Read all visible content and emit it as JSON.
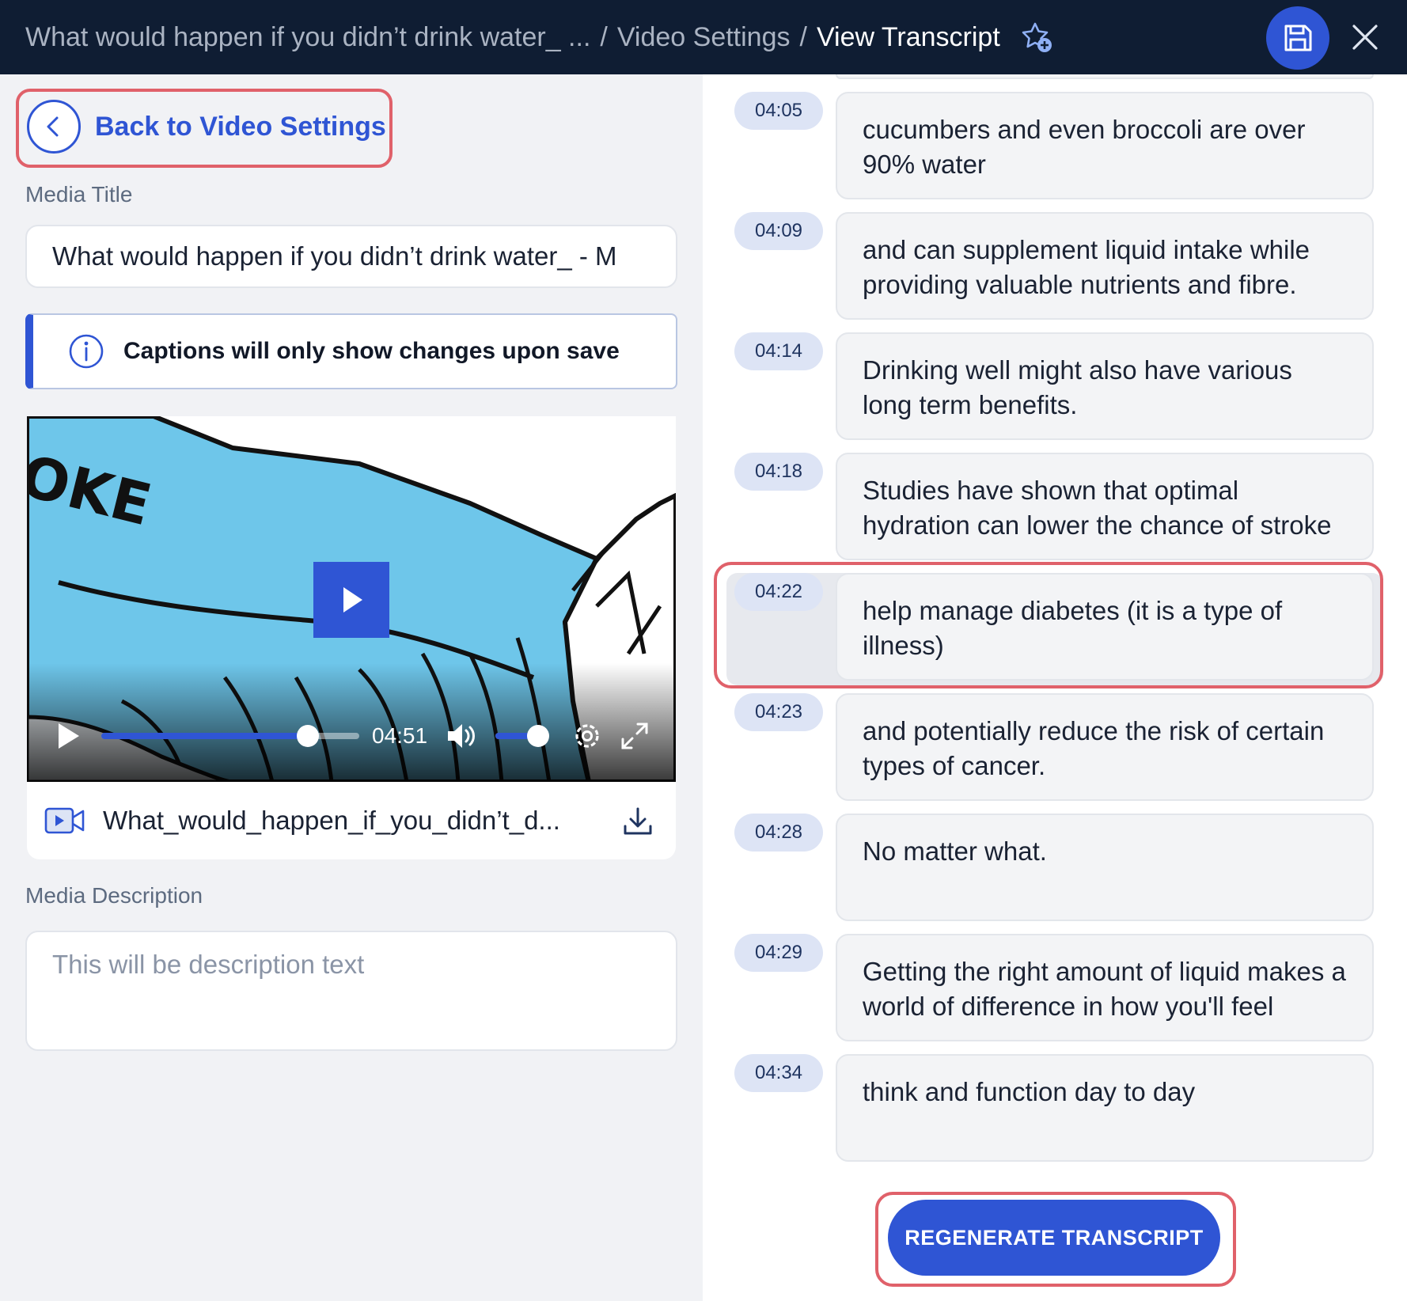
{
  "header": {
    "breadcrumb_media": "What would happen if you didn’t drink water_ ...",
    "breadcrumb_sep1": "/",
    "breadcrumb_section": "Video Settings",
    "breadcrumb_sep2": "/",
    "breadcrumb_current": "View Transcript",
    "favorite_icon": "star-plus-icon",
    "save_icon": "save-icon",
    "close_icon": "close-icon"
  },
  "back": {
    "label": "Back to Video Settings",
    "icon": "chevron-left-icon"
  },
  "media_title": {
    "label": "Media Title",
    "value": "What would happen if you didn’t drink water_ - M"
  },
  "notice": {
    "icon": "info-icon",
    "text": "Captions will only show changes upon save"
  },
  "player": {
    "caption_art_text": "OKE",
    "time": "04:51",
    "progress": 0.8,
    "volume": 0.85,
    "icons": [
      "play-icon",
      "volume-icon",
      "settings-icon",
      "fullscreen-icon"
    ]
  },
  "file": {
    "icon": "video-file-icon",
    "name": "What_would_happen_if_you_didn’t_d...",
    "download_icon": "download-icon"
  },
  "media_description": {
    "label": "Media Description",
    "placeholder": "This will be description text"
  },
  "transcript": {
    "segments": [
      {
        "time": "04:05",
        "text": "cucumbers and even broccoli are over 90% water"
      },
      {
        "time": "04:09",
        "text": "and can supplement liquid intake while providing valuable nutrients and fibre."
      },
      {
        "time": "04:14",
        "text": "Drinking well might also have various long term benefits."
      },
      {
        "time": "04:18",
        "text": "Studies have shown that optimal hydration can lower the chance of stroke"
      },
      {
        "time": "04:22",
        "text": "help manage diabetes (it is a type of illness)"
      },
      {
        "time": "04:23",
        "text": "and potentially reduce the risk of certain types of cancer."
      },
      {
        "time": "04:28",
        "text": "No matter what."
      },
      {
        "time": "04:29",
        "text": "Getting the right amount of liquid makes a world of difference in how you'll feel"
      },
      {
        "time": "04:34",
        "text": "think and function day to day"
      }
    ],
    "regenerate_label": "REGENERATE TRANSCRIPT"
  },
  "colors": {
    "header_bg": "#0f1d33",
    "accent": "#2f55d4",
    "highlight": "#e0616a",
    "panel_bg": "#f1f2f5",
    "video_water": "#6ec6ea"
  }
}
